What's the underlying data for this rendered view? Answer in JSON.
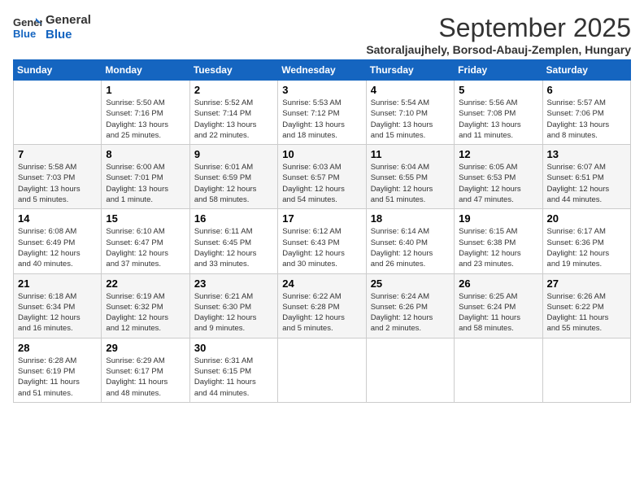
{
  "header": {
    "logo_line1": "General",
    "logo_line2": "Blue",
    "month": "September 2025",
    "location": "Satoraljaujhely, Borsod-Abauj-Zemplen, Hungary"
  },
  "columns": [
    "Sunday",
    "Monday",
    "Tuesday",
    "Wednesday",
    "Thursday",
    "Friday",
    "Saturday"
  ],
  "weeks": [
    [
      {
        "day": "",
        "info": ""
      },
      {
        "day": "1",
        "info": "Sunrise: 5:50 AM\nSunset: 7:16 PM\nDaylight: 13 hours\nand 25 minutes."
      },
      {
        "day": "2",
        "info": "Sunrise: 5:52 AM\nSunset: 7:14 PM\nDaylight: 13 hours\nand 22 minutes."
      },
      {
        "day": "3",
        "info": "Sunrise: 5:53 AM\nSunset: 7:12 PM\nDaylight: 13 hours\nand 18 minutes."
      },
      {
        "day": "4",
        "info": "Sunrise: 5:54 AM\nSunset: 7:10 PM\nDaylight: 13 hours\nand 15 minutes."
      },
      {
        "day": "5",
        "info": "Sunrise: 5:56 AM\nSunset: 7:08 PM\nDaylight: 13 hours\nand 11 minutes."
      },
      {
        "day": "6",
        "info": "Sunrise: 5:57 AM\nSunset: 7:06 PM\nDaylight: 13 hours\nand 8 minutes."
      }
    ],
    [
      {
        "day": "7",
        "info": "Sunrise: 5:58 AM\nSunset: 7:03 PM\nDaylight: 13 hours\nand 5 minutes."
      },
      {
        "day": "8",
        "info": "Sunrise: 6:00 AM\nSunset: 7:01 PM\nDaylight: 13 hours\nand 1 minute."
      },
      {
        "day": "9",
        "info": "Sunrise: 6:01 AM\nSunset: 6:59 PM\nDaylight: 12 hours\nand 58 minutes."
      },
      {
        "day": "10",
        "info": "Sunrise: 6:03 AM\nSunset: 6:57 PM\nDaylight: 12 hours\nand 54 minutes."
      },
      {
        "day": "11",
        "info": "Sunrise: 6:04 AM\nSunset: 6:55 PM\nDaylight: 12 hours\nand 51 minutes."
      },
      {
        "day": "12",
        "info": "Sunrise: 6:05 AM\nSunset: 6:53 PM\nDaylight: 12 hours\nand 47 minutes."
      },
      {
        "day": "13",
        "info": "Sunrise: 6:07 AM\nSunset: 6:51 PM\nDaylight: 12 hours\nand 44 minutes."
      }
    ],
    [
      {
        "day": "14",
        "info": "Sunrise: 6:08 AM\nSunset: 6:49 PM\nDaylight: 12 hours\nand 40 minutes."
      },
      {
        "day": "15",
        "info": "Sunrise: 6:10 AM\nSunset: 6:47 PM\nDaylight: 12 hours\nand 37 minutes."
      },
      {
        "day": "16",
        "info": "Sunrise: 6:11 AM\nSunset: 6:45 PM\nDaylight: 12 hours\nand 33 minutes."
      },
      {
        "day": "17",
        "info": "Sunrise: 6:12 AM\nSunset: 6:43 PM\nDaylight: 12 hours\nand 30 minutes."
      },
      {
        "day": "18",
        "info": "Sunrise: 6:14 AM\nSunset: 6:40 PM\nDaylight: 12 hours\nand 26 minutes."
      },
      {
        "day": "19",
        "info": "Sunrise: 6:15 AM\nSunset: 6:38 PM\nDaylight: 12 hours\nand 23 minutes."
      },
      {
        "day": "20",
        "info": "Sunrise: 6:17 AM\nSunset: 6:36 PM\nDaylight: 12 hours\nand 19 minutes."
      }
    ],
    [
      {
        "day": "21",
        "info": "Sunrise: 6:18 AM\nSunset: 6:34 PM\nDaylight: 12 hours\nand 16 minutes."
      },
      {
        "day": "22",
        "info": "Sunrise: 6:19 AM\nSunset: 6:32 PM\nDaylight: 12 hours\nand 12 minutes."
      },
      {
        "day": "23",
        "info": "Sunrise: 6:21 AM\nSunset: 6:30 PM\nDaylight: 12 hours\nand 9 minutes."
      },
      {
        "day": "24",
        "info": "Sunrise: 6:22 AM\nSunset: 6:28 PM\nDaylight: 12 hours\nand 5 minutes."
      },
      {
        "day": "25",
        "info": "Sunrise: 6:24 AM\nSunset: 6:26 PM\nDaylight: 12 hours\nand 2 minutes."
      },
      {
        "day": "26",
        "info": "Sunrise: 6:25 AM\nSunset: 6:24 PM\nDaylight: 11 hours\nand 58 minutes."
      },
      {
        "day": "27",
        "info": "Sunrise: 6:26 AM\nSunset: 6:22 PM\nDaylight: 11 hours\nand 55 minutes."
      }
    ],
    [
      {
        "day": "28",
        "info": "Sunrise: 6:28 AM\nSunset: 6:19 PM\nDaylight: 11 hours\nand 51 minutes."
      },
      {
        "day": "29",
        "info": "Sunrise: 6:29 AM\nSunset: 6:17 PM\nDaylight: 11 hours\nand 48 minutes."
      },
      {
        "day": "30",
        "info": "Sunrise: 6:31 AM\nSunset: 6:15 PM\nDaylight: 11 hours\nand 44 minutes."
      },
      {
        "day": "",
        "info": ""
      },
      {
        "day": "",
        "info": ""
      },
      {
        "day": "",
        "info": ""
      },
      {
        "day": "",
        "info": ""
      }
    ]
  ]
}
